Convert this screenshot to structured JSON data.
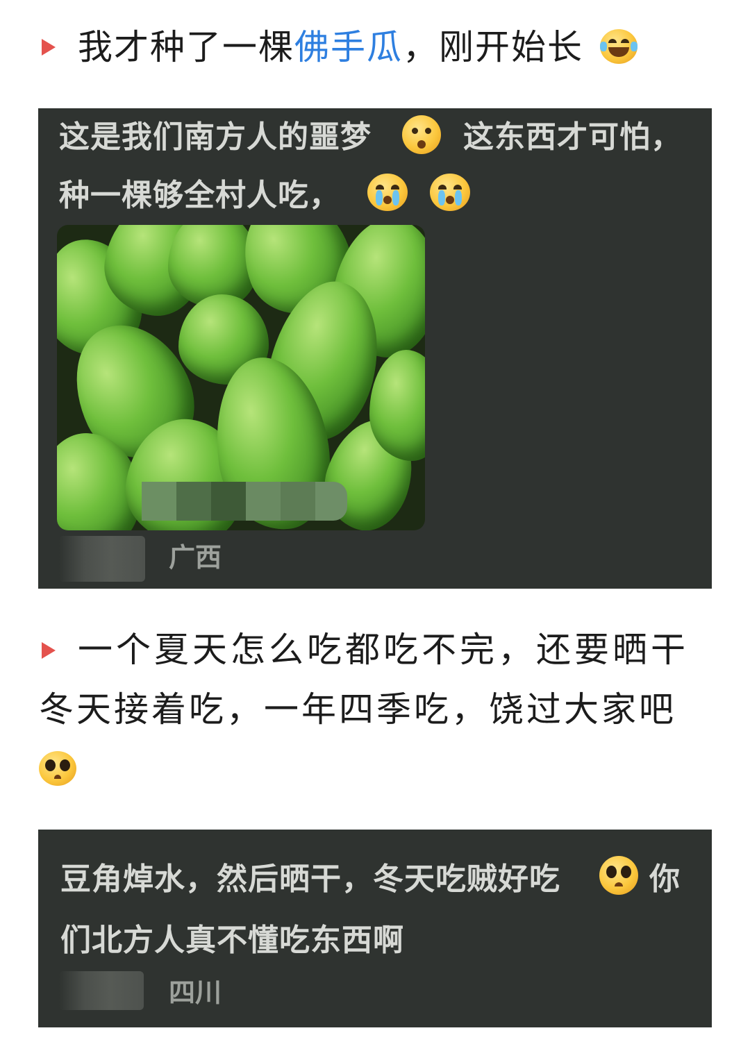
{
  "section1": {
    "heading_pre": "我才种了一棵",
    "heading_highlight": "佛手瓜",
    "heading_post": "，刚开始长",
    "heading_emoji": "tears-of-joy-emoji"
  },
  "comment1": {
    "line1_a": "这是我们南方人的噩梦",
    "line1_emoji": "dizzy-face-emoji",
    "line1_b": "这东西才可怕，",
    "line2": "种一棵够全村人吃，",
    "line2_emojis": [
      "crying-face-emoji",
      "crying-face-emoji"
    ],
    "image": "chayote-photo",
    "location": "广西"
  },
  "section2": {
    "line1": "一个夏天怎么吃都吃不完，还要晒干",
    "line2": "冬天接着吃，一年四季吃，饶过大家吧",
    "emoji": "pleading-face-emoji"
  },
  "comment2": {
    "line1_a": "豆角焯水，然后晒干，冬天吃贼好吃",
    "line1_emoji": "pleading-face-emoji",
    "line1_b": "你",
    "line2": "们北方人真不懂吃东西啊",
    "location": "四川"
  },
  "colors": {
    "bullet": "#e4524d",
    "highlight": "#2e7fe0",
    "panel": "#2f3330",
    "comment_text": "#d7d9d5",
    "location_text": "#9da19c"
  }
}
